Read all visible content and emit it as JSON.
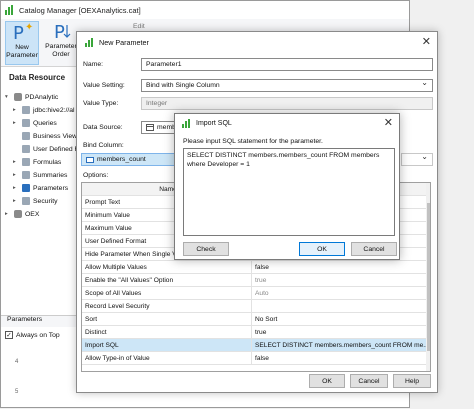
{
  "catalog_window": {
    "title": "Catalog Manager [OEXAnalytics.cat]",
    "toolbar": {
      "new_parameter": "New\nParameter",
      "parameter_order": "Parameter\nOrder",
      "edit": "Edit"
    },
    "data_resource_title": "Data Resource",
    "tree": [
      {
        "label": "PDAnalytic",
        "icon": "database-icon",
        "indent": 0,
        "toggle": "▾"
      },
      {
        "label": "jdbc:hive2://al",
        "icon": "connection-icon",
        "indent": 1,
        "toggle": "▸"
      },
      {
        "label": "Queries",
        "icon": "query-icon",
        "indent": 1,
        "toggle": "▸"
      },
      {
        "label": "Business Views",
        "icon": "business-view-icon",
        "indent": 1,
        "toggle": ""
      },
      {
        "label": "User Defined F",
        "icon": "user-defined-icon",
        "indent": 1,
        "toggle": ""
      },
      {
        "label": "Formulas",
        "icon": "formula-icon",
        "indent": 1,
        "toggle": "▸"
      },
      {
        "label": "Summaries",
        "icon": "summary-icon",
        "indent": 1,
        "toggle": "▸"
      },
      {
        "label": "Parameters",
        "icon": "parameter-icon",
        "indent": 1,
        "toggle": "▸"
      },
      {
        "label": "Security",
        "icon": "security-icon",
        "indent": 1,
        "toggle": "▸"
      },
      {
        "label": "OEX",
        "icon": "database-icon",
        "indent": 0,
        "toggle": "▸"
      }
    ],
    "parameters_tab": "Parameters",
    "always_on_top": "Always on Top",
    "ruler": [
      "4",
      "5"
    ]
  },
  "new_parameter_dialog": {
    "title": "New Parameter",
    "name_label": "Name:",
    "name_value": "Parameter1",
    "value_setting_label": "Value Setting:",
    "value_setting_value": "Bind with Single Column",
    "value_type_label": "Value Type:",
    "value_type_value": "Integer",
    "data_source_label": "Data Source:",
    "data_source_value": "member",
    "bind_column_label": "Bind Column:",
    "bind_column_value": "members_count",
    "options_label": "Options:",
    "grid_header": "Name",
    "rows": [
      {
        "name": "Prompt Text",
        "value": ""
      },
      {
        "name": "Minimum Value",
        "value": ""
      },
      {
        "name": "Maximum Value",
        "value": ""
      },
      {
        "name": "User Defined Format",
        "value": ""
      },
      {
        "name": "Hide Parameter When Single Value",
        "value": ""
      },
      {
        "name": "Allow Multiple Values",
        "value": "false"
      },
      {
        "name": "Enable the \"All Values\" Option",
        "value": "true"
      },
      {
        "name": "Scope of All Values",
        "value": "Auto"
      },
      {
        "name": "Record Level Security",
        "value": ""
      },
      {
        "name": "Sort",
        "value": "No Sort"
      },
      {
        "name": "Distinct",
        "value": "true"
      },
      {
        "name": "Import SQL",
        "value": "SELECT DISTINCT members.members_count FROM me..."
      },
      {
        "name": "Allow Type-in of Value",
        "value": "false"
      }
    ],
    "ok": "OK",
    "cancel": "Cancel",
    "help": "Help"
  },
  "import_sql_dialog": {
    "title": "Import SQL",
    "prompt": "Please input SQL statement for the parameter.",
    "sql_text": "SELECT DISTINCT members.members_count FROM members\nwhere Developer = 1",
    "check": "Check",
    "ok": "OK",
    "cancel": "Cancel"
  },
  "colors": {
    "accent": "#0078d7",
    "selection": "#cde6f7",
    "icon_green": "#3aa63a",
    "icon_blue": "#2a6fbd"
  }
}
